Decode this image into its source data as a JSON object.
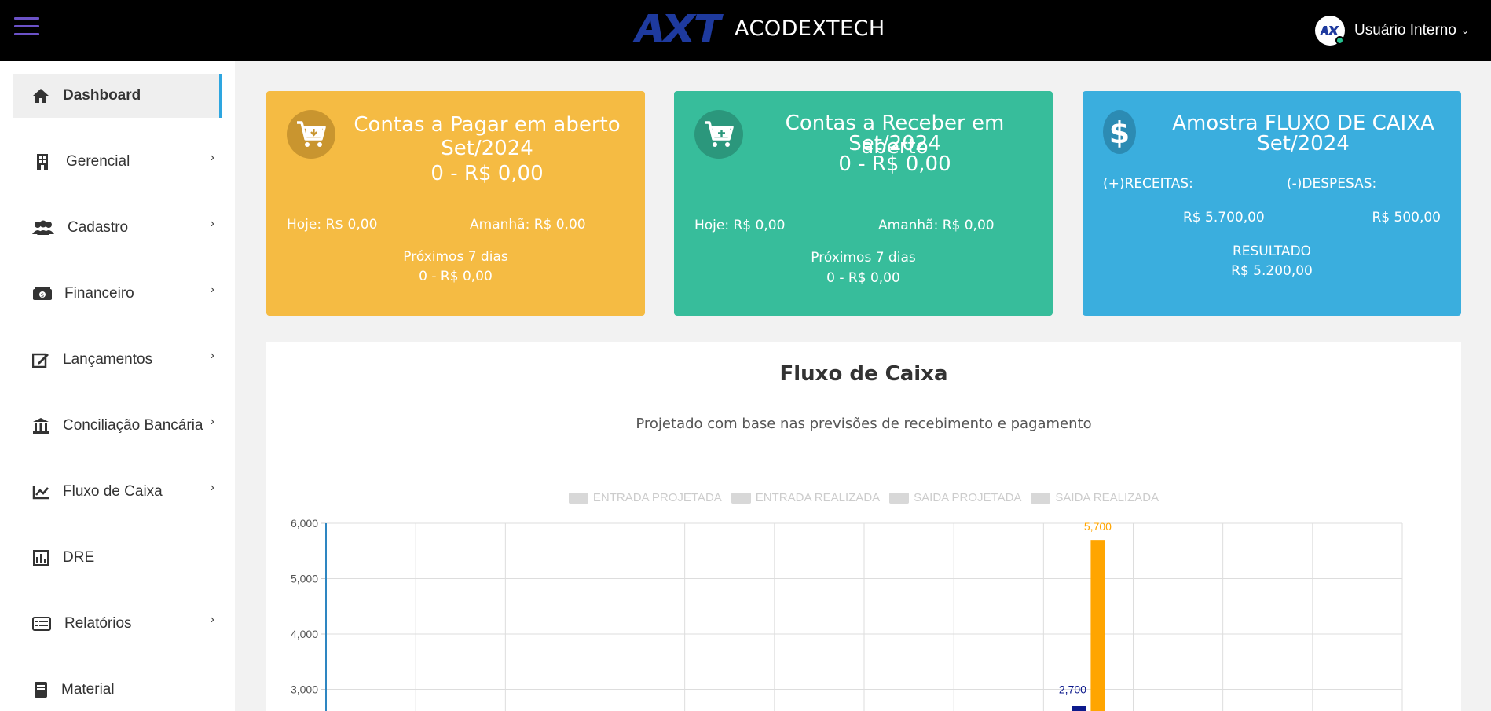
{
  "header": {
    "brand": "ACODEXTECH",
    "user_name": "Usuário Interno",
    "caret": "⌄"
  },
  "sidebar": {
    "items": [
      {
        "label": "Dashboard",
        "icon": "home-icon",
        "active": true,
        "has_chevron": false
      },
      {
        "label": "Gerencial",
        "icon": "building-icon",
        "has_chevron": true
      },
      {
        "label": "Cadastro",
        "icon": "users-icon",
        "has_chevron": true
      },
      {
        "label": "Financeiro",
        "icon": "money-icon",
        "has_chevron": true
      },
      {
        "label": "Lançamentos",
        "icon": "edit-icon",
        "has_chevron": true
      },
      {
        "label": "Conciliação Bancária",
        "icon": "bank-icon",
        "has_chevron": true
      },
      {
        "label": "Fluxo de Caixa",
        "icon": "chart-line-icon",
        "has_chevron": true
      },
      {
        "label": "DRE",
        "icon": "report-icon",
        "has_chevron": false
      },
      {
        "label": "Relatórios",
        "icon": "list-icon",
        "has_chevron": true
      },
      {
        "label": "Material",
        "icon": "book-icon",
        "has_chevron": false
      }
    ],
    "chevron": "›"
  },
  "cards": {
    "pagar": {
      "title_line1": "Contas a Pagar em aberto",
      "title_line2": "Set/2024",
      "value": "0 - R$ 0,00",
      "hoje": "Hoje: R$ 0,00",
      "amanha": "Amanhã: R$ 0,00",
      "proximos_label": "Próximos 7 dias",
      "proximos_value": "0 - R$ 0,00"
    },
    "receber": {
      "title_line1": "Contas a Receber em aberto",
      "title_line2": "Set/2024",
      "value": "0 - R$ 0,00",
      "hoje": "Hoje: R$ 0,00",
      "amanha": "Amanhã: R$ 0,00",
      "proximos_label": "Próximos 7 dias",
      "proximos_value": "0 - R$ 0,00"
    },
    "fluxo": {
      "title_line1": "Amostra FLUXO DE CAIXA",
      "title_line2": "Set/2024",
      "receitas_label": "(+)RECEITAS:",
      "despesas_label": "(-)DESPESAS:",
      "receitas_value": "R$ 5.700,00",
      "despesas_value": "R$ 500,00",
      "resultado_label": "RESULTADO",
      "resultado_value": "R$ 5.200,00"
    }
  },
  "chart_panel": {
    "title": "Fluxo de Caixa",
    "subtitle": "Projetado com base nas previsões de recebimento e pagamento"
  },
  "colors": {
    "card_yellow": "#f5bb43",
    "card_green": "#37bd9b",
    "card_blue": "#3aaede",
    "series_entrada_projetada": "#0d1a8c",
    "series_entrada_realizada": "#ffa500"
  },
  "chart_data": {
    "type": "bar",
    "title": "Fluxo de Caixa",
    "subtitle": "Projetado com base nas previsões de recebimento e pagamento",
    "legend_position": "top",
    "grid": true,
    "ylim": [
      0,
      6000
    ],
    "yticks": [
      "3,000",
      "4,000",
      "5,000",
      "6,000"
    ],
    "ytick_values": [
      3000,
      4000,
      5000,
      6000
    ],
    "num_categories": 12,
    "series": [
      {
        "name": "ENTRADA PROJETADA",
        "color": "#0d1a8c",
        "values": [
          null,
          null,
          null,
          null,
          null,
          null,
          null,
          null,
          2700,
          null,
          null,
          null
        ],
        "labels": [
          "",
          "",
          "",
          "",
          "",
          "",
          "",
          "",
          "2,700",
          "",
          "",
          ""
        ]
      },
      {
        "name": "ENTRADA REALIZADA",
        "color": "#ffa500",
        "values": [
          null,
          null,
          null,
          null,
          null,
          null,
          null,
          null,
          5700,
          null,
          null,
          null
        ],
        "labels": [
          "",
          "",
          "",
          "",
          "",
          "",
          "",
          "",
          "5,700",
          "",
          "",
          ""
        ]
      },
      {
        "name": "SAIDA PROJETADA",
        "color": "#d8d8d8",
        "values": []
      },
      {
        "name": "SAIDA REALIZADA",
        "color": "#d8d8d8",
        "values": []
      }
    ]
  }
}
